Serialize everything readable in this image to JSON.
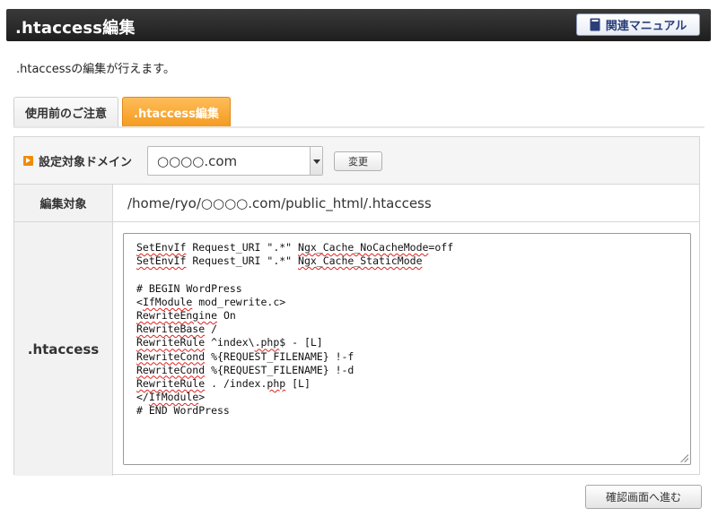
{
  "header": {
    "title": ".htaccess編集",
    "manual_button": {
      "label": "関連マニュアル",
      "icon": "book-icon"
    }
  },
  "lead_text": ".htaccessの編集が行えます。",
  "tabs": [
    {
      "label": "使用前のご注意",
      "active": false
    },
    {
      "label": ".htaccess編集",
      "active": true
    }
  ],
  "domain_row": {
    "label": "設定対象ドメイン",
    "selected_domain": "○○○○.com",
    "change_button": "変更"
  },
  "target_row": {
    "label": "編集対象",
    "path": "/home/ryo/○○○○.com/public_html/.htaccess"
  },
  "htaccess_row": {
    "label": ".htaccess",
    "lines": [
      "SetEnvIf Request_URI \".*\" Ngx_Cache_NoCacheMode=off",
      "SetEnvIf Request_URI \".*\" Ngx_Cache_StaticMode",
      "",
      "# BEGIN WordPress",
      "<IfModule mod_rewrite.c>",
      "RewriteEngine On",
      "RewriteBase /",
      "RewriteRule ^index\\.php$ - [L]",
      "RewriteCond %{REQUEST_FILENAME} !-f",
      "RewriteCond %{REQUEST_FILENAME} !-d",
      "RewriteRule . /index.php [L]",
      "</IfModule>",
      "# END WordPress"
    ]
  },
  "confirm_button": "確認画面へ進む",
  "colors": {
    "header_bg": "#262626",
    "tab_active": "#f39a1e",
    "domain_icon": "#f08c00",
    "spell_underline": "#e02020"
  }
}
